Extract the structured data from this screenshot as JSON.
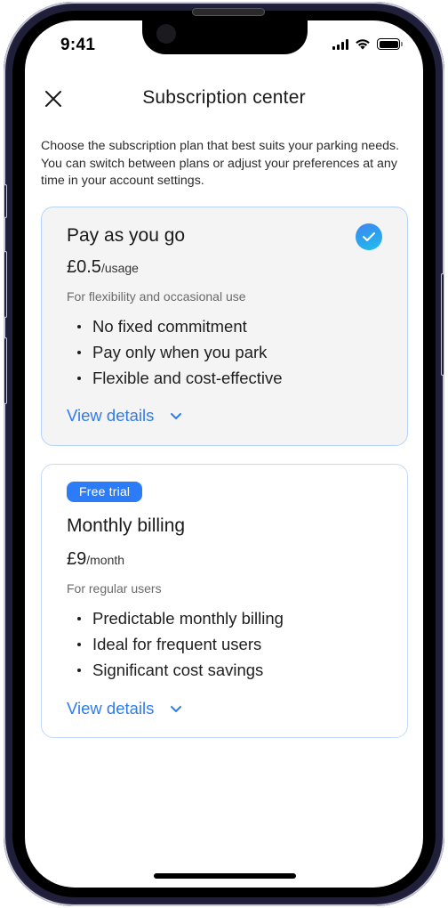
{
  "status_bar": {
    "time": "9:41",
    "icons": [
      "cellular-signal-icon",
      "wifi-icon",
      "battery-icon"
    ]
  },
  "header": {
    "title": "Subscription center",
    "close_icon": "close-icon"
  },
  "intro_text": "Choose the subscription plan that best suits your parking needs. You can switch between plans or adjust your preferences at any time in your account settings.",
  "plans": [
    {
      "title": "Pay as you go",
      "price": "£0.5",
      "price_unit": "/usage",
      "subtitle": "For flexibility and occasional use",
      "features": [
        "No fixed commitment",
        "Pay only when you park",
        "Flexible and cost-effective"
      ],
      "view_details_label": "View details",
      "selected": true,
      "badge": null
    },
    {
      "title": "Monthly billing",
      "price": "£9",
      "price_unit": "/month",
      "subtitle": "For regular users",
      "features": [
        "Predictable monthly billing",
        "Ideal for frequent users",
        "Significant cost savings"
      ],
      "view_details_label": "View details",
      "selected": false,
      "badge": "Free trial"
    }
  ],
  "colors": {
    "accent": "#2f7bef",
    "badge_bg": "#2b7cf6",
    "card_border": "#c5dafb",
    "selected_card_bg": "#f4f4f4"
  }
}
